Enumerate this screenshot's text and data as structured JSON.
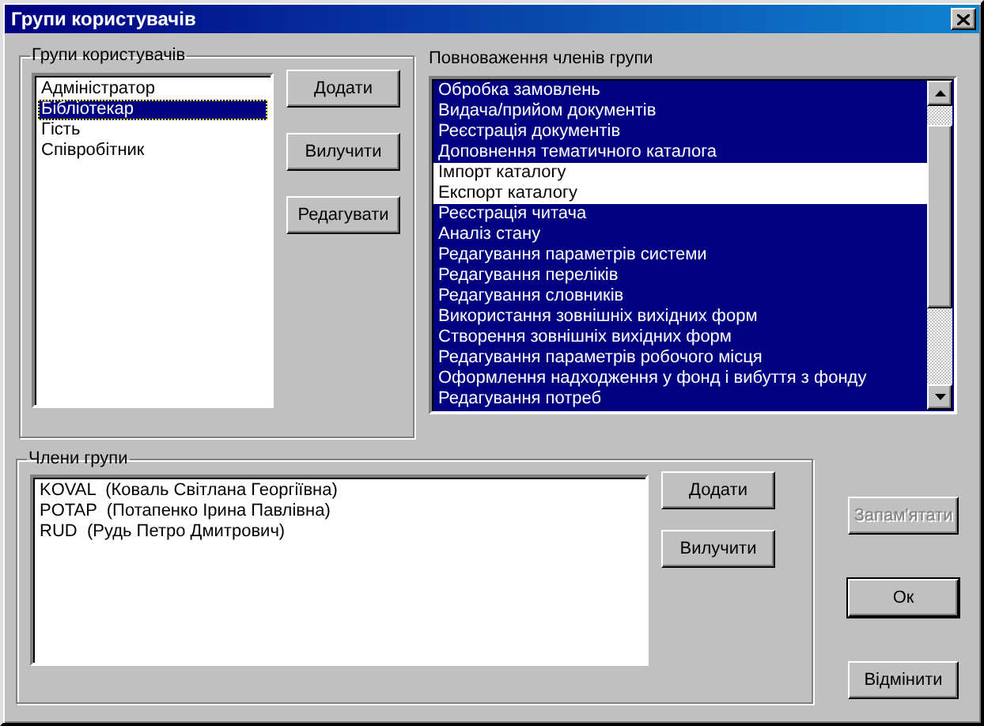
{
  "window": {
    "title": "Групи користувачів"
  },
  "groups": {
    "label": "Групи користувачів",
    "items": [
      {
        "name": "Адміністратор",
        "selected": false
      },
      {
        "name": "Бібліотекар",
        "selected": true
      },
      {
        "name": "Гість",
        "selected": false
      },
      {
        "name": "Співробітник",
        "selected": false
      }
    ],
    "buttons": [
      {
        "label": "Додати"
      },
      {
        "label": "Вилучити"
      },
      {
        "label": "Редагувати"
      }
    ]
  },
  "permissions": {
    "label": "Повноваження членів групи",
    "items": [
      {
        "name": "Обробка замовлень",
        "selected": true
      },
      {
        "name": "Видача/прийом документів",
        "selected": true
      },
      {
        "name": "Реєстрація документів",
        "selected": true
      },
      {
        "name": "Доповнення тематичного каталога",
        "selected": true
      },
      {
        "name": "Імпорт каталогу",
        "selected": false
      },
      {
        "name": "Експорт каталогу",
        "selected": false
      },
      {
        "name": "Реєстрація читача",
        "selected": true
      },
      {
        "name": "Аналіз стану",
        "selected": true
      },
      {
        "name": "Редагування параметрів системи",
        "selected": true
      },
      {
        "name": "Редагування переліків",
        "selected": true
      },
      {
        "name": "Редагування словників",
        "selected": true
      },
      {
        "name": "Використання зовнішніх вихідних форм",
        "selected": true
      },
      {
        "name": "Створення зовнішніх вихідних форм",
        "selected": true
      },
      {
        "name": "Редагування параметрів робочого місця",
        "selected": true
      },
      {
        "name": "Оформлення надходження у фонд і вибуття з фонду",
        "selected": true
      },
      {
        "name": "Редагування потреб",
        "selected": true
      }
    ]
  },
  "members": {
    "label": "Члени групи",
    "items": [
      {
        "name": "KOVAL  (Коваль Світлана Георгіївна)"
      },
      {
        "name": "POTAP  (Потапенко Ірина Павлівна)"
      },
      {
        "name": "RUD  (Рудь Петро Дмитрович)"
      }
    ],
    "buttons": [
      {
        "label": "Додати"
      },
      {
        "label": "Вилучити"
      }
    ]
  },
  "dialog_buttons": [
    {
      "label": "Запам'ятати",
      "disabled": true
    },
    {
      "label": "Ок",
      "disabled": false,
      "default": true
    },
    {
      "label": "Відмінити",
      "disabled": false,
      "default": false
    }
  ]
}
